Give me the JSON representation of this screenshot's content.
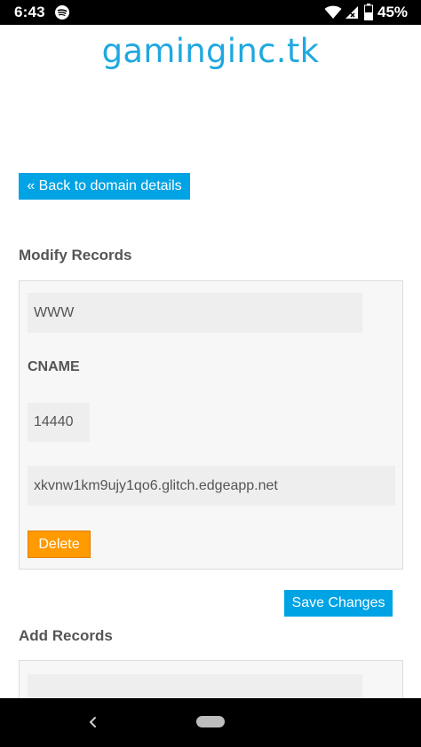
{
  "status_bar": {
    "time": "6:43",
    "battery": "45%",
    "icons": [
      "spotify-icon",
      "wifi-icon",
      "signal-icon",
      "battery-icon"
    ]
  },
  "site": {
    "title": "gaminginc.tk",
    "accent_color": "#1fa8e0"
  },
  "actions": {
    "back_label": "« Back to domain details",
    "save_label": "Save Changes",
    "delete_label": "Delete",
    "button_color": "#00a3e4",
    "delete_color": "#ff9a00"
  },
  "modify": {
    "heading": "Modify Records",
    "record": {
      "host": "WWW",
      "type": "CNAME",
      "ttl": "14440",
      "target": "xkvnw1km9ujy1qo6.glitch.edgeapp.net"
    }
  },
  "add": {
    "heading": "Add Records",
    "host": ""
  },
  "nav": {
    "icons": [
      "back-icon",
      "home-pill-icon"
    ]
  }
}
